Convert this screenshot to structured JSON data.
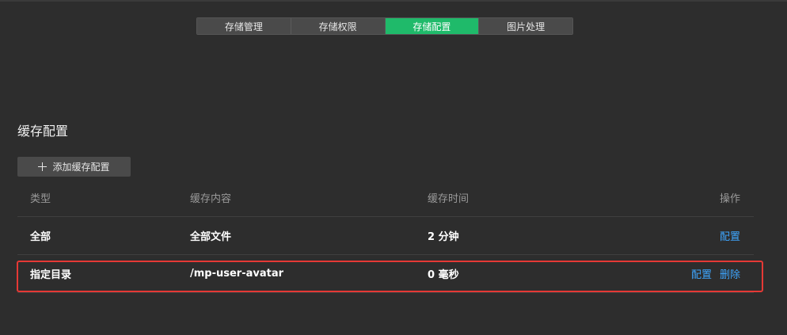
{
  "tabs": [
    {
      "label": "存储管理",
      "active": false
    },
    {
      "label": "存储权限",
      "active": false
    },
    {
      "label": "存储配置",
      "active": true
    },
    {
      "label": "图片处理",
      "active": false
    }
  ],
  "section": {
    "title": "缓存配置",
    "add_button_label": "添加缓存配置"
  },
  "table": {
    "headers": {
      "type": "类型",
      "content": "缓存内容",
      "time": "缓存时间",
      "ops": "操作"
    },
    "rows": [
      {
        "type": "全部",
        "content": "全部文件",
        "time": "2 分钟",
        "ops": [
          "配置"
        ]
      },
      {
        "type": "指定目录",
        "content": "/mp-user-avatar",
        "time": "0 毫秒",
        "ops": [
          "配置",
          "删除"
        ]
      }
    ]
  },
  "colors": {
    "active_tab": "#1fba6a",
    "link": "#3ea6ff",
    "highlight": "#e53935",
    "background": "#2d2d2d"
  }
}
